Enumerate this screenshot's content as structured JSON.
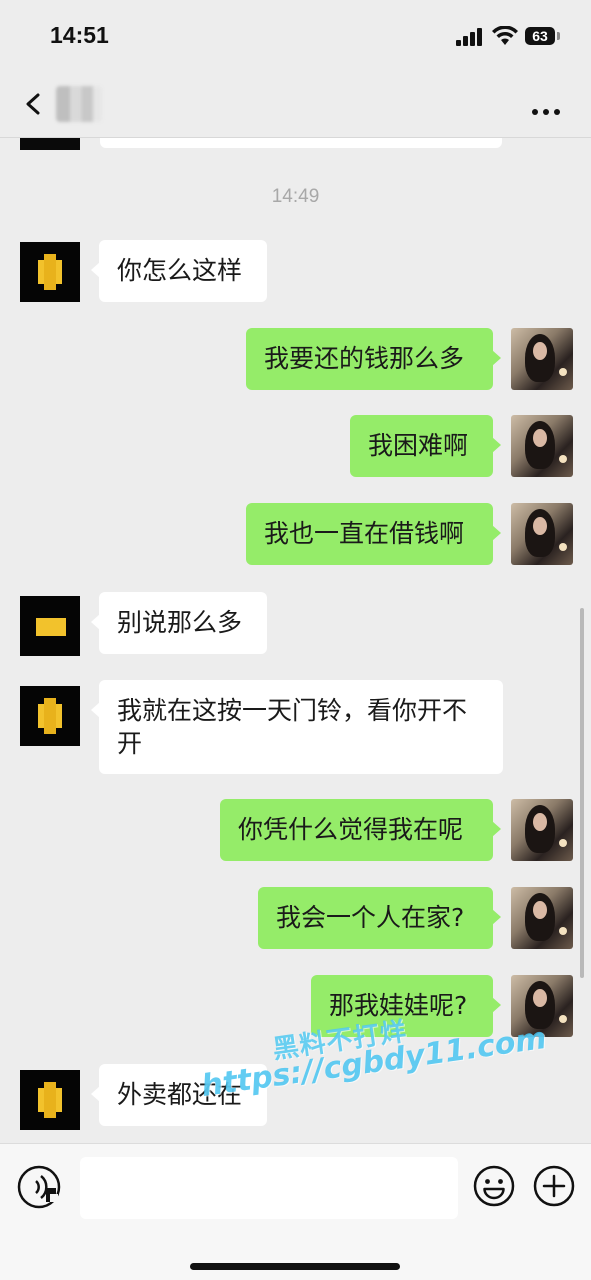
{
  "status_bar": {
    "time": "14:51",
    "battery": "63"
  },
  "nav": {
    "back_icon": "chevron-left-icon",
    "contact_name": "",
    "more_icon": "ellipsis-icon"
  },
  "chat": {
    "timestamp": "14:49",
    "messages": [
      {
        "side": "left",
        "text": "你怎么这样"
      },
      {
        "side": "right",
        "text": "我要还的钱那么多"
      },
      {
        "side": "right",
        "text": "我困难啊"
      },
      {
        "side": "right",
        "text": "我也一直在借钱啊"
      },
      {
        "side": "left",
        "text": "别说那么多"
      },
      {
        "side": "left",
        "text": "我就在这按一天门铃，看你开不",
        "text2": "开"
      },
      {
        "side": "right",
        "text": "你凭什么觉得我在呢"
      },
      {
        "side": "right",
        "text": "我会一个人在家?"
      },
      {
        "side": "right",
        "text": "那我娃娃呢?"
      },
      {
        "side": "left",
        "text": "外卖都还在"
      }
    ]
  },
  "watermark": {
    "line1": "黑料不打烊",
    "line2": "https://cgbdy11.com"
  },
  "input_bar": {
    "voice_icon": "voice-icon",
    "input_value": "",
    "emoji_icon": "emoji-icon",
    "plus_icon": "plus-icon"
  },
  "colors": {
    "background": "#ededed",
    "bubble_self": "#95ec69",
    "bubble_other": "#ffffff"
  }
}
